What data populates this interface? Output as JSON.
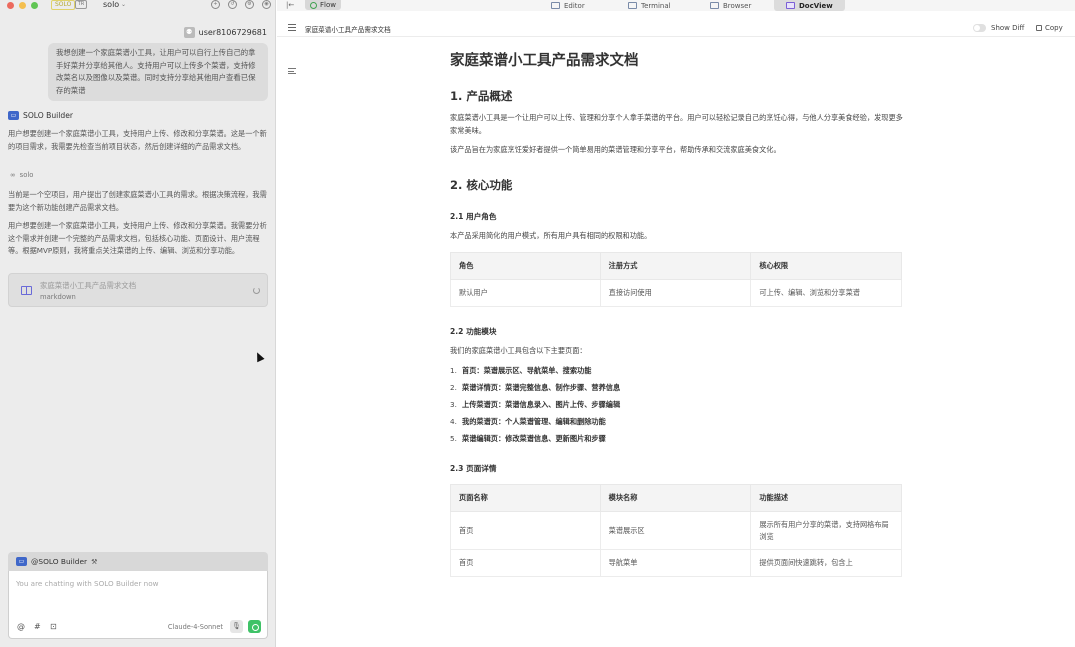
{
  "titlebar": {
    "solo_badge": "SOLO",
    "trae_badge": "TR",
    "project_name": "solo",
    "project_chevron": "⌄"
  },
  "user": {
    "name": "user8106729681",
    "avatar": "⚉"
  },
  "user_message": "我想创建一个家庭菜谱小工具，让用户可以自行上传自己的拿手好菜并分享给其他人。支持用户可以上传多个菜谱，支持修改菜名以及图像以及菜谱。同时支持分享给其他用户查看已保存的菜谱",
  "assistant": {
    "name": "SOLO Builder",
    "p1": "用户想要创建一个家庭菜谱小工具，支持用户上传、修改和分享菜谱。这是一个新的项目需求，我需要先检查当前项目状态，然后创建详细的产品需求文档。",
    "thinking_label": "solo",
    "p2": "当前是一个空项目，用户提出了创建家庭菜谱小工具的需求。根据决策流程，我需要为这个新功能创建产品需求文档。",
    "p3": "用户想要创建一个家庭菜谱小工具，支持用户上传、修改和分享菜谱。我需要分析这个需求并创建一个完整的产品需求文档，包括核心功能、页面设计、用户流程等。根据MVP原则，我将重点关注菜谱的上传、编辑、浏览和分享功能。",
    "file_card": {
      "title": "家庭菜谱小工具产品需求文档",
      "type": "markdown"
    }
  },
  "chat": {
    "mention": "@SOLO Builder",
    "tool_icon": "⚒",
    "placeholder": "You are chatting with SOLO Builder now",
    "icons": {
      "at": "@",
      "hash": "#",
      "image": "⊡"
    },
    "model": "Claude-4-Sonnet",
    "mic": "🎙"
  },
  "tabs": {
    "collapse": "|←",
    "flow": "Flow",
    "editor": "Editor",
    "terminal": "Terminal",
    "browser": "Browser",
    "docview": "DocView"
  },
  "docbar": {
    "title": "家庭菜谱小工具产品需求文档",
    "show_diff": "Show Diff",
    "copy": "Copy"
  },
  "doc": {
    "title": "家庭菜谱小工具产品需求文档",
    "s1_heading": "1. 产品概述",
    "s1_p1": "家庭菜谱小工具是一个让用户可以上传、管理和分享个人拿手菜谱的平台。用户可以轻松记录自己的烹饪心得，与他人分享美食经验，发现更多家常美味。",
    "s1_p2": "该产品旨在为家庭烹饪爱好者提供一个简单易用的菜谱管理和分享平台，帮助传承和交流家庭美食文化。",
    "s2_heading": "2. 核心功能",
    "s21_heading": "2.1 用户角色",
    "s21_p": "本产品采用简化的用户模式，所有用户具有相同的权限和功能。",
    "roles_table": {
      "headers": [
        "角色",
        "注册方式",
        "核心权限"
      ],
      "rows": [
        [
          "默认用户",
          "直接访问使用",
          "可上传、编辑、浏览和分享菜谱"
        ]
      ]
    },
    "s22_heading": "2.2 功能模块",
    "s22_p": "我们的家庭菜谱小工具包含以下主要页面：",
    "modules": [
      {
        "num": "1.",
        "name": "首页",
        "desc": "：菜谱展示区、导航菜单、搜索功能"
      },
      {
        "num": "2.",
        "name": "菜谱详情页",
        "desc": "：菜谱完整信息、制作步骤、营养信息"
      },
      {
        "num": "3.",
        "name": "上传菜谱页",
        "desc": "：菜谱信息录入、图片上传、步骤编辑"
      },
      {
        "num": "4.",
        "name": "我的菜谱页",
        "desc": "：个人菜谱管理、编辑和删除功能"
      },
      {
        "num": "5.",
        "name": "菜谱编辑页",
        "desc": "：修改菜谱信息、更新图片和步骤"
      }
    ],
    "s23_heading": "2.3 页面详情",
    "pages_table": {
      "headers": [
        "页面名称",
        "模块名称",
        "功能描述"
      ],
      "rows": [
        [
          "首页",
          "菜谱展示区",
          "展示所有用户分享的菜谱，支持网格布局浏览"
        ],
        [
          "首页",
          "导航菜单",
          "提供页面间快速跳转，包含上"
        ]
      ]
    }
  }
}
